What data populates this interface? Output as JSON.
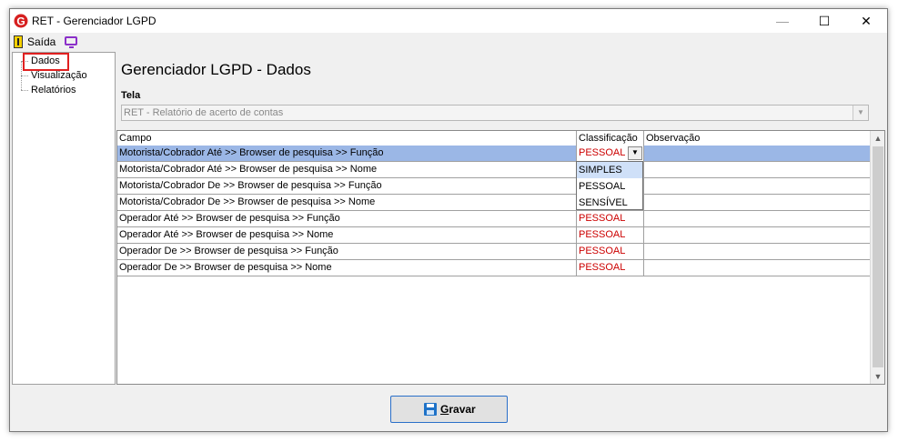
{
  "window": {
    "title": "RET - Gerenciador LGPD",
    "minimize": "—",
    "maximize": "☐",
    "close": "✕"
  },
  "menu": {
    "exit_label": "Saída"
  },
  "tree": {
    "items": [
      {
        "label": "Dados",
        "selected": true
      },
      {
        "label": "Visualização"
      },
      {
        "label": "Relatórios"
      }
    ]
  },
  "main": {
    "title": "Gerenciador LGPD - Dados",
    "tela_label": "Tela",
    "tela_value": "RET - Relatório de acerto de contas"
  },
  "grid": {
    "columns": [
      "Campo",
      "Classificação",
      "Observação"
    ],
    "rows": [
      {
        "campo": "Motorista/Cobrador Até >> Browser de pesquisa >> Função",
        "classificacao": "PESSOAL",
        "observacao": ""
      },
      {
        "campo": "Motorista/Cobrador Até >> Browser de pesquisa >> Nome",
        "classificacao": "",
        "observacao": ""
      },
      {
        "campo": "Motorista/Cobrador De >> Browser de pesquisa >> Função",
        "classificacao": "",
        "observacao": ""
      },
      {
        "campo": "Motorista/Cobrador De >> Browser de pesquisa >> Nome",
        "classificacao": "",
        "observacao": ""
      },
      {
        "campo": "Operador Até >> Browser de pesquisa >> Função",
        "classificacao": "PESSOAL",
        "observacao": ""
      },
      {
        "campo": "Operador Até >> Browser de pesquisa >> Nome",
        "classificacao": "PESSOAL",
        "observacao": ""
      },
      {
        "campo": "Operador De >> Browser de pesquisa >> Função",
        "classificacao": "PESSOAL",
        "observacao": ""
      },
      {
        "campo": "Operador De >> Browser de pesquisa >> Nome",
        "classificacao": "PESSOAL",
        "observacao": ""
      }
    ],
    "dropdown_options": [
      "SIMPLES",
      "PESSOAL",
      "SENSÍVEL"
    ],
    "dropdown_highlighted": "SIMPLES"
  },
  "footer": {
    "save_prefix": "G",
    "save_rest": "ravar"
  },
  "colors": {
    "selection": "#9bb7e6",
    "classification_text": "#cc0000",
    "highlight_border": "#e02020"
  }
}
